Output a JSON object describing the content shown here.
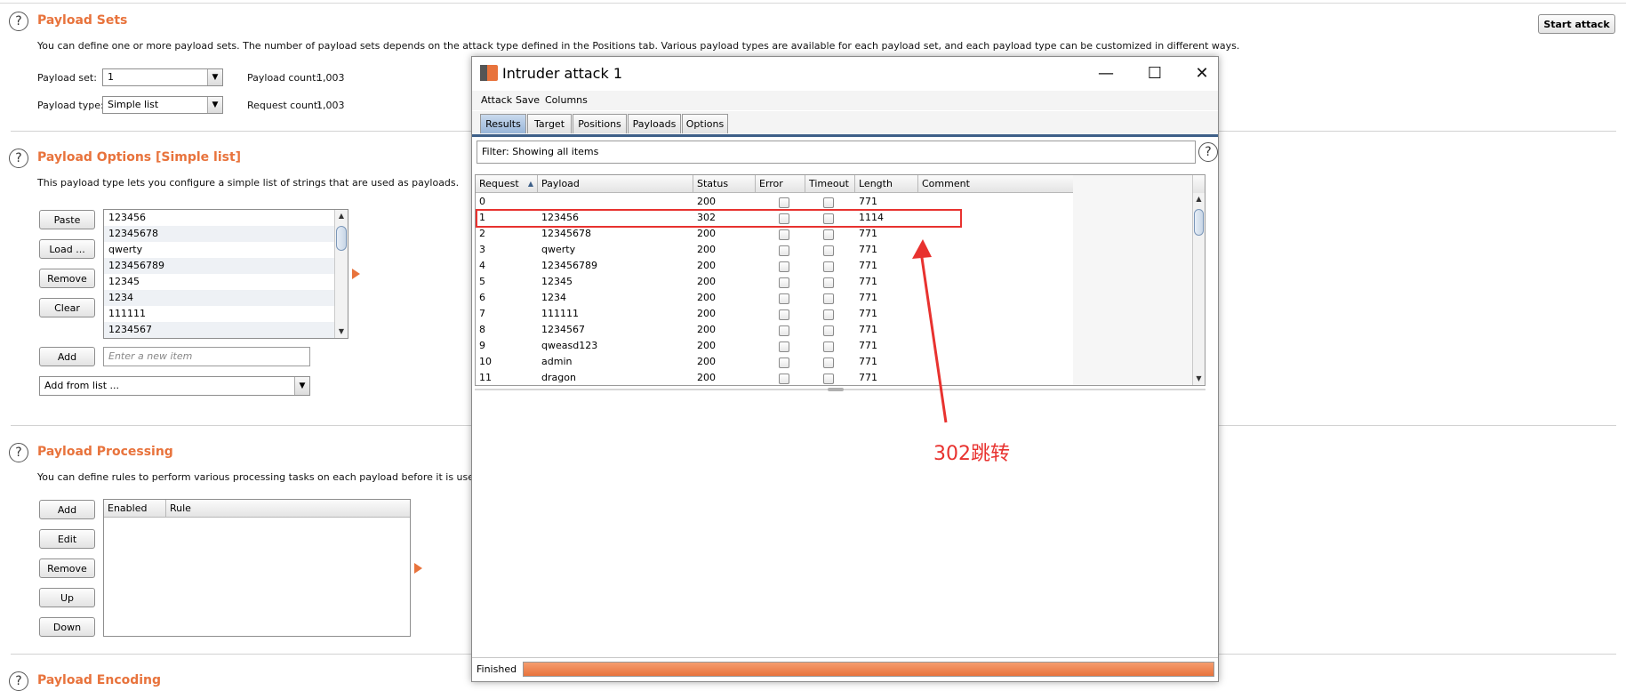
{
  "header": {
    "start_attack": "Start attack"
  },
  "payload_sets": {
    "title": "Payload Sets",
    "desc": "You can define one or more payload sets. The number of payload sets depends on the attack type defined in the Positions tab. Various payload types are available for each payload set, and each payload type can be customized in different ways.",
    "set_label": "Payload set:",
    "set_value": "1",
    "type_label": "Payload type:",
    "type_value": "Simple list",
    "payload_count_label": "Payload count:",
    "payload_count": "1,003",
    "request_count_label": "Request count:",
    "request_count": "1,003"
  },
  "payload_options": {
    "title": "Payload Options [Simple list]",
    "desc": "This payload type lets you configure a simple list of strings that are used as payloads.",
    "buttons": {
      "paste": "Paste",
      "load": "Load ...",
      "remove": "Remove",
      "clear": "Clear",
      "add": "Add"
    },
    "items": [
      "123456",
      "12345678",
      "qwerty",
      "123456789",
      "12345",
      "1234",
      "111111",
      "1234567"
    ],
    "new_item_placeholder": "Enter a new item",
    "add_from_list": "Add from list ..."
  },
  "payload_processing": {
    "title": "Payload Processing",
    "desc": "You can define rules to perform various processing tasks on each payload before it is used.",
    "buttons": {
      "add": "Add",
      "edit": "Edit",
      "remove": "Remove",
      "up": "Up",
      "down": "Down"
    },
    "columns": [
      "Enabled",
      "Rule"
    ]
  },
  "payload_encoding": {
    "title": "Payload Encoding"
  },
  "window": {
    "title": "Intruder attack 1",
    "controls": {
      "minimize": "—",
      "maximize": "☐",
      "close": "✕"
    },
    "menu": [
      "Attack",
      "Save",
      "Columns"
    ],
    "tabs": [
      "Results",
      "Target",
      "Positions",
      "Payloads",
      "Options"
    ],
    "filter": "Filter:  Showing all items",
    "columns": [
      "Request",
      "Payload",
      "Status",
      "Error",
      "Timeout",
      "Length",
      "Comment"
    ],
    "rows": [
      [
        "0",
        "",
        "200",
        "771"
      ],
      [
        "1",
        "123456",
        "302",
        "1114"
      ],
      [
        "2",
        "12345678",
        "200",
        "771"
      ],
      [
        "3",
        "qwerty",
        "200",
        "771"
      ],
      [
        "4",
        "123456789",
        "200",
        "771"
      ],
      [
        "5",
        "12345",
        "200",
        "771"
      ],
      [
        "6",
        "1234",
        "200",
        "771"
      ],
      [
        "7",
        "111111",
        "200",
        "771"
      ],
      [
        "8",
        "1234567",
        "200",
        "771"
      ],
      [
        "9",
        "qweasd123",
        "200",
        "771"
      ],
      [
        "10",
        "admin",
        "200",
        "771"
      ],
      [
        "11",
        "dragon",
        "200",
        "771"
      ]
    ],
    "status": "Finished",
    "progress": 1.0
  },
  "annotation": {
    "text": "302跳转",
    "color": "#e8322f"
  },
  "colors": {
    "accent": "#e8733c",
    "tab_active": "#98b5d8",
    "highlight": "#e8322f"
  }
}
